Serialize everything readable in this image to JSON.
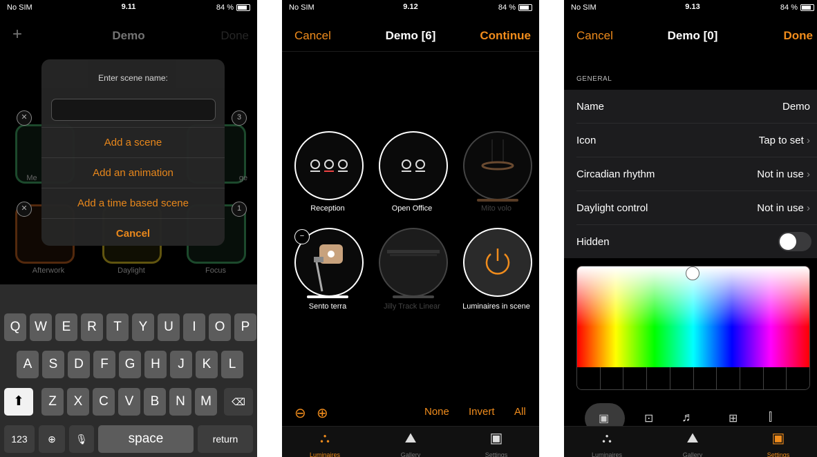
{
  "screens": [
    {
      "status": {
        "carrier": "No SIM",
        "time": "9.11",
        "battery": "84 %"
      },
      "nav": {
        "left": "+",
        "title": "Demo",
        "right": "Done"
      },
      "background_tiles": {
        "labels": [
          "Me",
          "ge",
          "Afterwork",
          "Daylight",
          "Focus"
        ],
        "badges": [
          "3",
          "1"
        ]
      },
      "dialog": {
        "title": "Enter scene name:",
        "input_value": "",
        "options": [
          "Add a scene",
          "Add an animation",
          "Add a time based scene",
          "Cancel"
        ]
      },
      "keyboard": {
        "row1": [
          "Q",
          "W",
          "E",
          "R",
          "T",
          "Y",
          "U",
          "I",
          "O",
          "P"
        ],
        "row2": [
          "A",
          "S",
          "D",
          "F",
          "G",
          "H",
          "J",
          "K",
          "L"
        ],
        "row3": [
          "Z",
          "X",
          "C",
          "V",
          "B",
          "N",
          "M"
        ],
        "numbers": "123",
        "space": "space",
        "return": "return"
      }
    },
    {
      "status": {
        "carrier": "No SIM",
        "time": "9.12",
        "battery": "84 %"
      },
      "nav": {
        "left": "Cancel",
        "title": "Demo [6]",
        "right": "Continue"
      },
      "luminaires": [
        {
          "label": "Reception"
        },
        {
          "label": "Open Office"
        },
        {
          "label": "Mito volo"
        },
        {
          "label": "Sento terra"
        },
        {
          "label": "Jilly Track Linear"
        },
        {
          "label": "Luminaires in scene"
        }
      ],
      "controls": {
        "none": "None",
        "invert": "Invert",
        "all": "All"
      },
      "tabs": [
        "Luminaires",
        "Gallery",
        "Settings"
      ]
    },
    {
      "status": {
        "carrier": "No SIM",
        "time": "9.13",
        "battery": "84 %"
      },
      "nav": {
        "left": "Cancel",
        "title": "Demo [0]",
        "right": "Done"
      },
      "section": "GENERAL",
      "rows": [
        {
          "key": "Name",
          "value": "Demo"
        },
        {
          "key": "Icon",
          "value": "Tap to set"
        },
        {
          "key": "Circadian rhythm",
          "value": "Not in use"
        },
        {
          "key": "Daylight control",
          "value": "Not in use"
        },
        {
          "key": "Hidden",
          "value": ""
        }
      ],
      "tabs": [
        "Luminaires",
        "Gallery",
        "Settings"
      ]
    }
  ],
  "colors": {
    "accent": "#f08c1c"
  }
}
